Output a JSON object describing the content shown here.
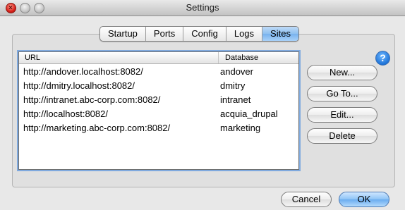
{
  "window": {
    "title": "Settings"
  },
  "tabs": [
    {
      "label": "Startup",
      "active": false
    },
    {
      "label": "Ports",
      "active": false
    },
    {
      "label": "Config",
      "active": false
    },
    {
      "label": "Logs",
      "active": false
    },
    {
      "label": "Sites",
      "active": true
    }
  ],
  "sites_table": {
    "columns": {
      "url": "URL",
      "database": "Database"
    },
    "rows": [
      {
        "url": "http://andover.localhost:8082/",
        "database": "andover"
      },
      {
        "url": "http://dmitry.localhost:8082/",
        "database": "dmitry"
      },
      {
        "url": "http://intranet.abc-corp.com:8082/",
        "database": "intranet"
      },
      {
        "url": "http://localhost:8082/",
        "database": "acquia_drupal"
      },
      {
        "url": "http://marketing.abc-corp.com:8082/",
        "database": "marketing"
      }
    ]
  },
  "side_buttons": {
    "help": "?",
    "new": "New...",
    "goto": "Go To...",
    "edit": "Edit...",
    "delete": "Delete"
  },
  "footer": {
    "cancel": "Cancel",
    "ok": "OK"
  },
  "icons": {
    "close": "close-icon",
    "minimize": "minimize-icon",
    "zoom": "zoom-icon",
    "help": "help-icon"
  },
  "colors": {
    "accent": "#78b2ee",
    "close_button": "#d8211b"
  }
}
